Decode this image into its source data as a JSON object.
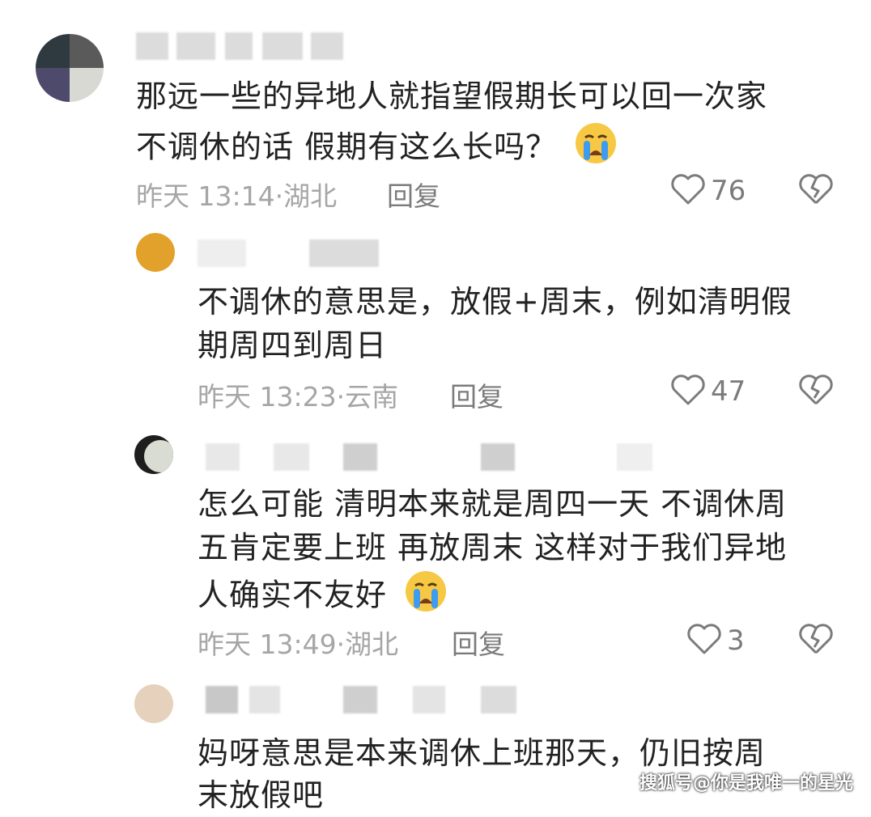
{
  "comments": [
    {
      "lines": [
        "那远一些的异地人就指望假期长可以回一次家",
        "不调休的话 假期有这么长吗？"
      ],
      "time": "昨天 13:14·湖北",
      "reply": "回复",
      "likes": "76",
      "has_emoji": "crying-face"
    },
    {
      "lines": [
        "不调休的意思是，放假+周末，例如清明假",
        "期周四到周日"
      ],
      "time": "昨天 13:23·云南",
      "reply": "回复",
      "likes": "47"
    },
    {
      "lines": [
        "怎么可能 清明本来就是周四一天 不调休周",
        "五肯定要上班 再放周末 这样对于我们异地",
        "人确实不友好"
      ],
      "time": "昨天 13:49·湖北",
      "reply": "回复",
      "likes": "3",
      "has_emoji": "crying-face"
    },
    {
      "lines": [
        "妈呀意思是本来调休上班那天，仍旧按周",
        "末放假吧"
      ]
    }
  ],
  "watermark": "搜狐号@你是我唯一的星光",
  "colors": {
    "meta_gray": "#a6a6a6",
    "text": "#222222",
    "emoji_yellow": "#f7c843",
    "tear_blue": "#3d9cf0"
  }
}
